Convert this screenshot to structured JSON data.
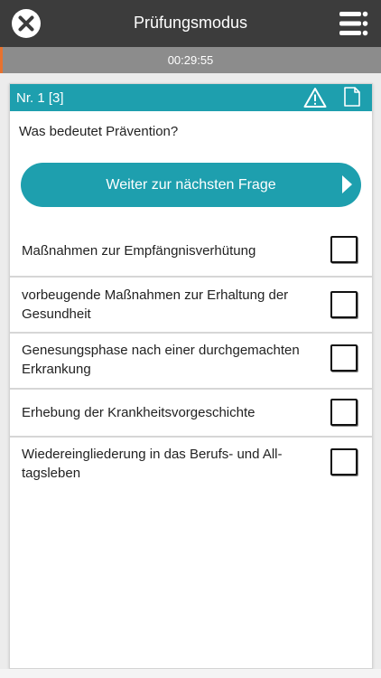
{
  "header": {
    "title": "Prüfungsmodus",
    "close_icon": "close-circle-icon",
    "menu_icon": "menu-list-icon"
  },
  "timer": {
    "time": "00:29:55",
    "accent_color": "#e8722f"
  },
  "question_card": {
    "number_label": "Nr. 1 [3]",
    "warning_icon": "warning-icon",
    "note_icon": "note-icon",
    "question": "Was bedeutet Prävention?",
    "next_button_label": "Weiter zur nächsten Frage",
    "accent_color": "#1e9fae",
    "answers": [
      {
        "text": "Maßnahmen zur Empfängnisverhütung",
        "checked": false
      },
      {
        "text": "vorbeugende Maßnahmen zur Erhaltung der Gesundheit",
        "checked": false
      },
      {
        "text": "Genesungsphase nach einer durchgemachten Erkrankung",
        "checked": false
      },
      {
        "text": "Erhebung der Krankheitsvorgeschichte",
        "checked": false
      },
      {
        "text": "Wiedereingliederung in das Berufs- und All-tagsleben",
        "checked": false
      }
    ]
  }
}
